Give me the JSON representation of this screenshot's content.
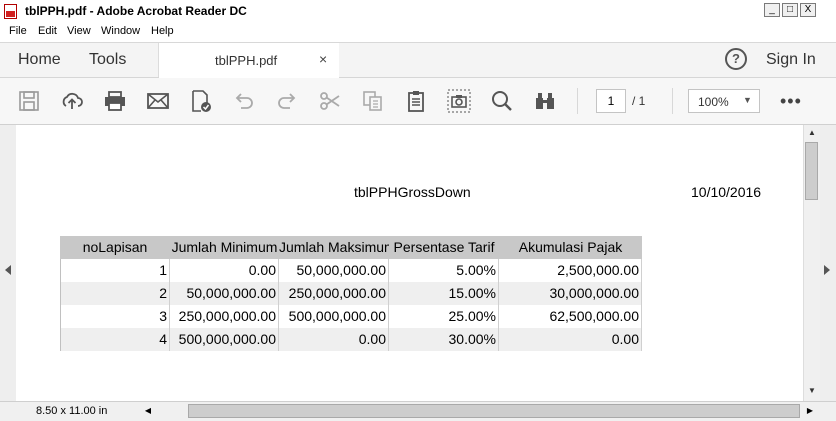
{
  "window": {
    "title": "tblPPH.pdf - Adobe Acrobat Reader DC",
    "controls": {
      "minimize": "_",
      "maximize": "□",
      "close": "X"
    }
  },
  "menu": [
    "File",
    "Edit",
    "View",
    "Window",
    "Help"
  ],
  "nav": {
    "home": "Home",
    "tools": "Tools",
    "tab_label": "tblPPH.pdf",
    "tab_close": "×",
    "help": "?",
    "signin": "Sign In"
  },
  "toolbar": {
    "icons": [
      "save-icon",
      "upload-icon",
      "print-icon",
      "email-icon",
      "convert-icon",
      "undo-icon",
      "redo-icon",
      "cut-icon",
      "copy-icon",
      "paste-icon",
      "snapshot-icon",
      "search-icon",
      "read-mode-icon"
    ],
    "page_current": "1",
    "page_total": "/ 1",
    "zoom": "100%",
    "more": "•••"
  },
  "document": {
    "title": "tblPPHGrossDown",
    "date": "10/10/2016",
    "table": {
      "headers": [
        "noLapisan",
        "Jumlah Minimum",
        "Jumlah Maksimum",
        "Persentase Tarif",
        "Akumulasi Pajak"
      ],
      "rows": [
        [
          "1",
          "0.00",
          "50,000,000.00",
          "5.00%",
          "2,500,000.00"
        ],
        [
          "2",
          "50,000,000.00",
          "250,000,000.00",
          "15.00%",
          "30,000,000.00"
        ],
        [
          "3",
          "250,000,000.00",
          "500,000,000.00",
          "25.00%",
          "62,500,000.00"
        ],
        [
          "4",
          "500,000,000.00",
          "0.00",
          "30.00%",
          "0.00"
        ]
      ]
    }
  },
  "status": {
    "page_size": "8.50 x 11.00 in"
  }
}
